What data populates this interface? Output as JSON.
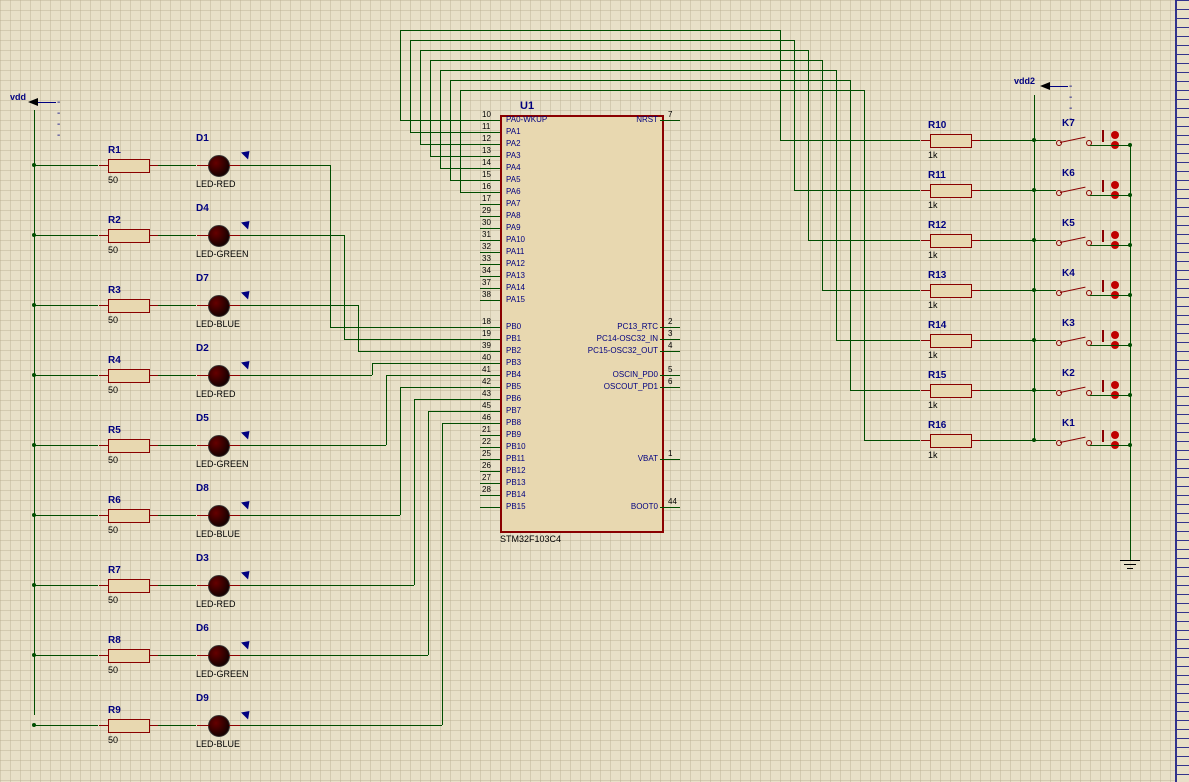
{
  "ic": {
    "ref": "U1",
    "part": "STM32F103C4",
    "left_pins": [
      {
        "num": "10",
        "name": "PA0-WKUP"
      },
      {
        "num": "11",
        "name": "PA1"
      },
      {
        "num": "12",
        "name": "PA2"
      },
      {
        "num": "13",
        "name": "PA3"
      },
      {
        "num": "14",
        "name": "PA4"
      },
      {
        "num": "15",
        "name": "PA5"
      },
      {
        "num": "16",
        "name": "PA6"
      },
      {
        "num": "17",
        "name": "PA7"
      },
      {
        "num": "29",
        "name": "PA8"
      },
      {
        "num": "30",
        "name": "PA9"
      },
      {
        "num": "31",
        "name": "PA10"
      },
      {
        "num": "32",
        "name": "PA11"
      },
      {
        "num": "33",
        "name": "PA12"
      },
      {
        "num": "34",
        "name": "PA13"
      },
      {
        "num": "37",
        "name": "PA14"
      },
      {
        "num": "38",
        "name": "PA15"
      },
      {
        "num": "18",
        "name": "PB0"
      },
      {
        "num": "19",
        "name": "PB1"
      },
      {
        "num": "39",
        "name": "PB2"
      },
      {
        "num": "40",
        "name": "PB3"
      },
      {
        "num": "41",
        "name": "PB4"
      },
      {
        "num": "42",
        "name": "PB5"
      },
      {
        "num": "43",
        "name": "PB6"
      },
      {
        "num": "45",
        "name": "PB7"
      },
      {
        "num": "46",
        "name": "PB8"
      },
      {
        "num": "21",
        "name": "PB9"
      },
      {
        "num": "22",
        "name": "PB10"
      },
      {
        "num": "25",
        "name": "PB11"
      },
      {
        "num": "26",
        "name": "PB12"
      },
      {
        "num": "27",
        "name": "PB13"
      },
      {
        "num": "28",
        "name": "PB14"
      },
      {
        "num": "",
        "name": "PB15"
      }
    ],
    "right_pins": [
      {
        "num": "7",
        "name": "NRST",
        "row": 0
      },
      {
        "num": "2",
        "name": "PC13_RTC",
        "row": 16
      },
      {
        "num": "3",
        "name": "PC14-OSC32_IN",
        "row": 17
      },
      {
        "num": "4",
        "name": "PC15-OSC32_OUT",
        "row": 18
      },
      {
        "num": "5",
        "name": "OSCIN_PD0",
        "row": 20
      },
      {
        "num": "6",
        "name": "OSCOUT_PD1",
        "row": 21
      },
      {
        "num": "1",
        "name": "VBAT",
        "row": 27
      },
      {
        "num": "44",
        "name": "BOOT0",
        "row": 31
      }
    ]
  },
  "vdd_left": "vdd",
  "vdd_right": "vdd2",
  "leds": [
    {
      "ref": "D1",
      "type": "LED-RED",
      "rref": "R1",
      "rval": "50"
    },
    {
      "ref": "D4",
      "type": "LED-GREEN",
      "rref": "R2",
      "rval": "50"
    },
    {
      "ref": "D7",
      "type": "LED-BLUE",
      "rref": "R3",
      "rval": "50"
    },
    {
      "ref": "D2",
      "type": "LED-RED",
      "rref": "R4",
      "rval": "50"
    },
    {
      "ref": "D5",
      "type": "LED-GREEN",
      "rref": "R5",
      "rval": "50"
    },
    {
      "ref": "D8",
      "type": "LED-BLUE",
      "rref": "R6",
      "rval": "50"
    },
    {
      "ref": "D3",
      "type": "LED-RED",
      "rref": "R7",
      "rval": "50"
    },
    {
      "ref": "D6",
      "type": "LED-GREEN",
      "rref": "R8",
      "rval": "50"
    },
    {
      "ref": "D9",
      "type": "LED-BLUE",
      "rref": "R9",
      "rval": "50"
    }
  ],
  "switches": [
    {
      "ref": "K7",
      "rref": "R10",
      "rval": "1k"
    },
    {
      "ref": "K6",
      "rref": "R11",
      "rval": "1k"
    },
    {
      "ref": "K5",
      "rref": "R12",
      "rval": "1k"
    },
    {
      "ref": "K4",
      "rref": "R13",
      "rval": "1k"
    },
    {
      "ref": "K3",
      "rref": "R14",
      "rval": "1k"
    },
    {
      "ref": "K2",
      "rref": "R15",
      "rval": "1k"
    },
    {
      "ref": "K1",
      "rref": "R16",
      "rval": "1k"
    }
  ]
}
